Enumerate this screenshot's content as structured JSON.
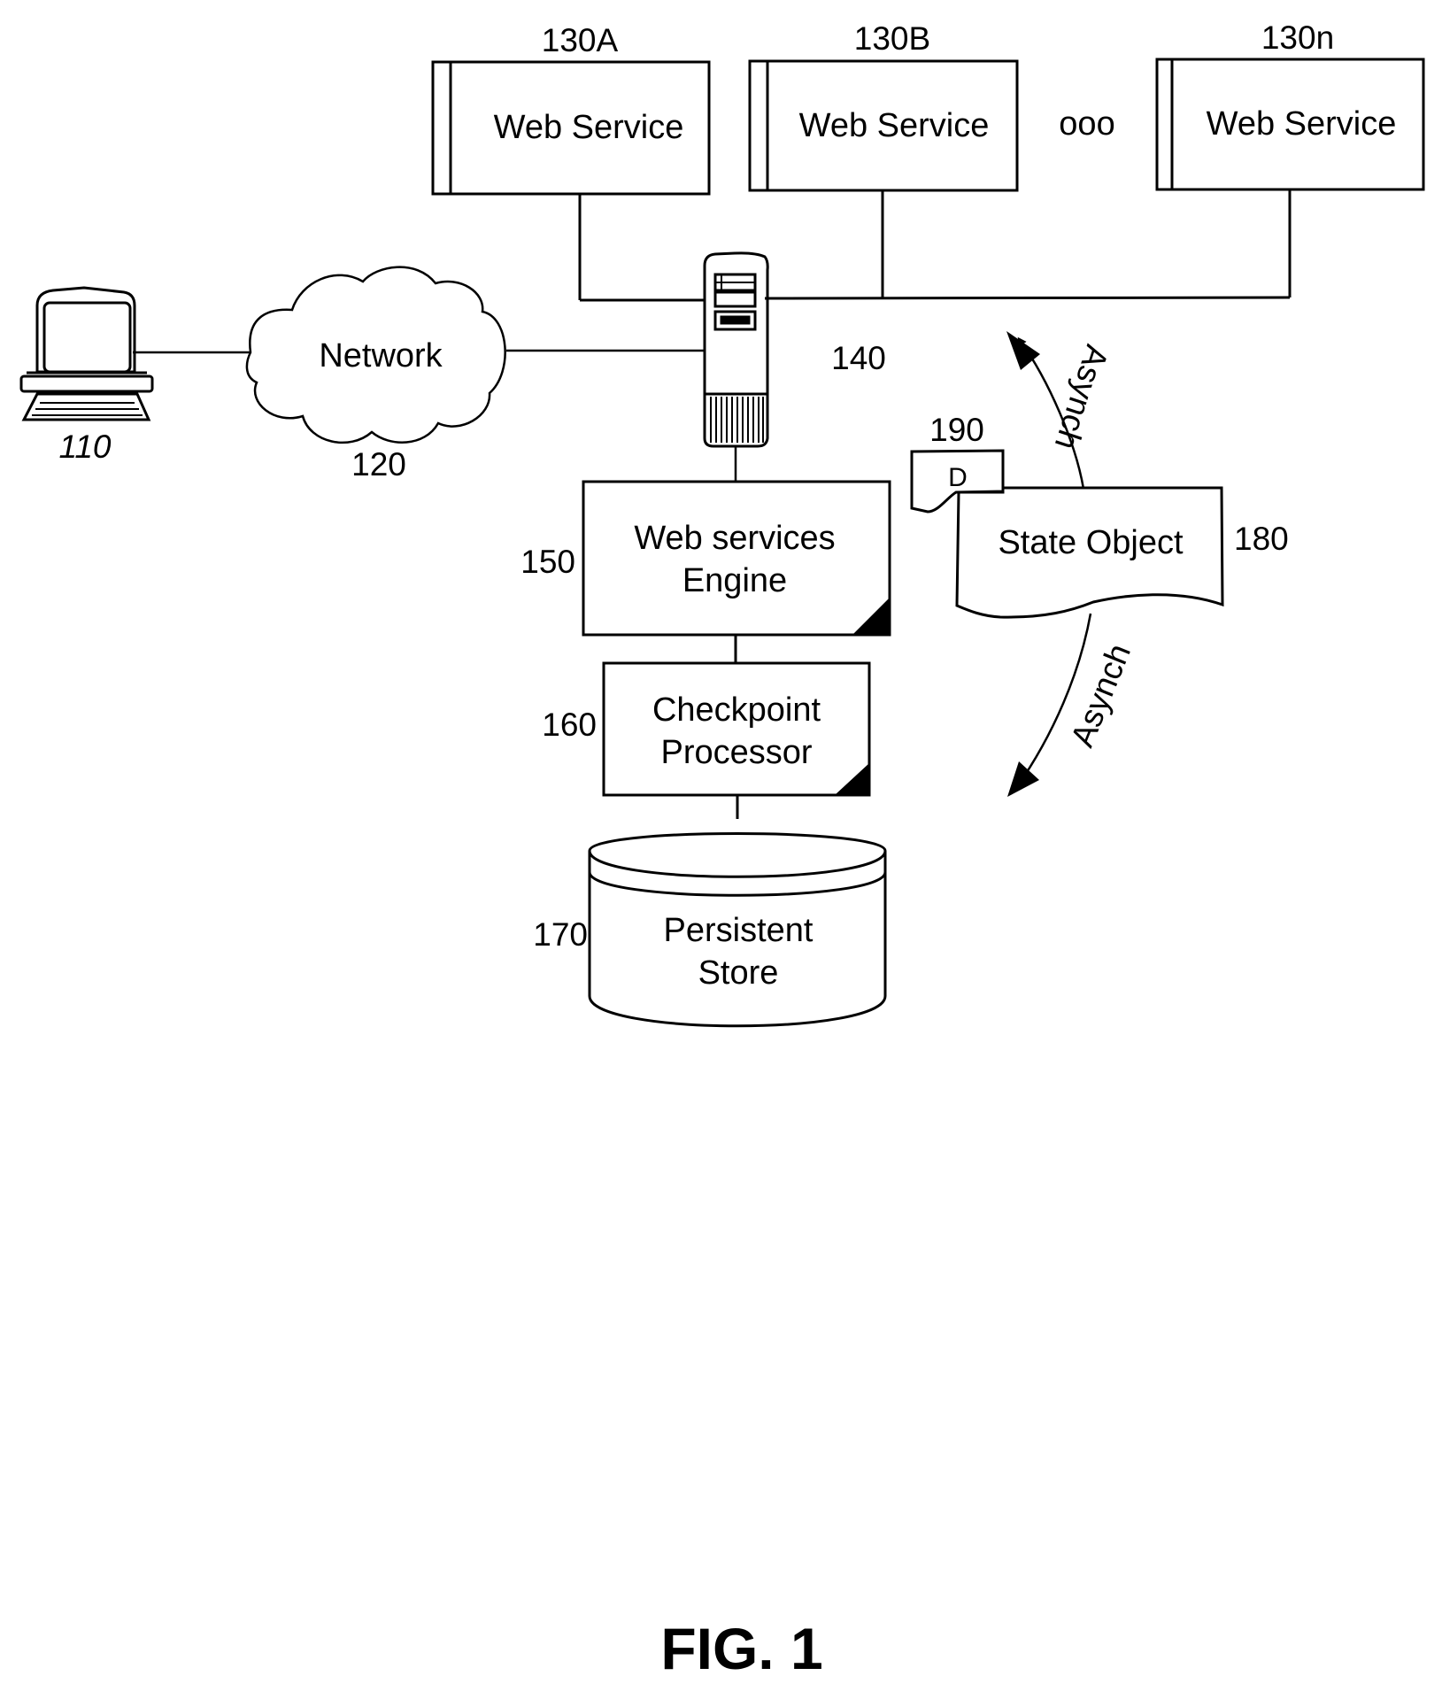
{
  "figure": {
    "caption": "FIG. 1",
    "nodes": {
      "client": {
        "ref": "110",
        "icon": "computer-icon"
      },
      "network": {
        "ref": "120",
        "label": "Network",
        "icon": "cloud-icon"
      },
      "web_services": [
        {
          "ref": "130A",
          "label": "Web Service"
        },
        {
          "ref": "130B",
          "label": "Web Service"
        },
        {
          "ref": "130n",
          "label": "Web Service"
        }
      ],
      "ellipsis": "ooo",
      "server": {
        "ref": "140",
        "icon": "server-tower-icon"
      },
      "engine": {
        "ref": "150",
        "line1": "Web services",
        "line2": "Engine"
      },
      "checkpoint": {
        "ref": "160",
        "line1": "Checkpoint",
        "line2": "Processor"
      },
      "store": {
        "ref": "170",
        "line1": "Persistent",
        "line2": "Store",
        "icon": "database-cylinder-icon"
      },
      "state_object": {
        "ref": "180",
        "label": "State Object",
        "icon": "document-icon"
      },
      "delta": {
        "ref": "190",
        "label": "D",
        "icon": "document-icon"
      }
    },
    "arrows": {
      "upper": {
        "label": "Asynch",
        "direction": "up"
      },
      "lower": {
        "label": "Asynch",
        "direction": "down"
      }
    }
  }
}
